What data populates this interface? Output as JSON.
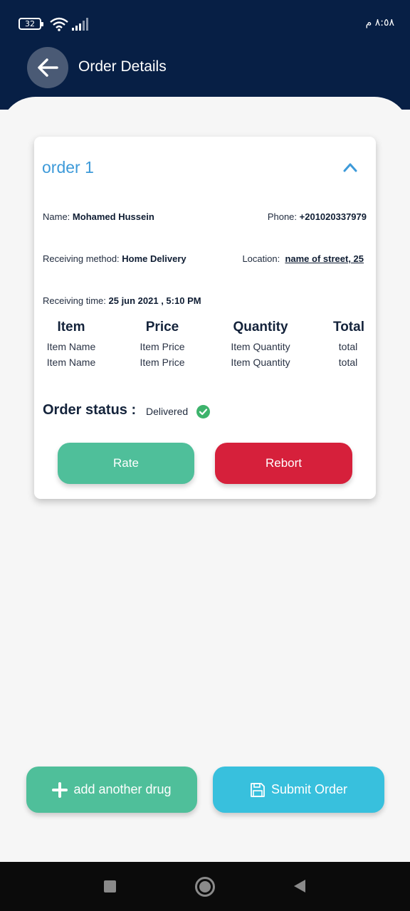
{
  "status_bar": {
    "battery": "32",
    "time": "٨:٥٨ م",
    "wifi_icon": "wifi-icon",
    "signal_icon": "signal-icon"
  },
  "header": {
    "title": "Order Details",
    "back_icon": "arrow-left-icon"
  },
  "order": {
    "title": "order 1",
    "name_label": "Name:",
    "name_value": "Mohamed Hussein",
    "phone_label": "Phone:",
    "phone_value": "+201020337979",
    "method_label": "Receiving method:",
    "method_value": "Home Delivery",
    "location_label": "Location:",
    "location_value": "name of street, 25",
    "time_label": "Receiving time:",
    "time_value": "25 jun 2021 , 5:10 PM",
    "table": {
      "headers": [
        "Item",
        "Price",
        "Quantity",
        "Total"
      ],
      "rows": [
        [
          "Item Name",
          "Item Price",
          "Item Quantity",
          "total"
        ],
        [
          "Item Name",
          "Item Price",
          "Item Quantity",
          "total"
        ]
      ]
    },
    "status_label": "Order status :",
    "status_value": "Delivered",
    "rate_label": "Rate",
    "report_label": "Rebort"
  },
  "actions": {
    "add_label": "add another drug",
    "submit_label": "Submit Order"
  },
  "colors": {
    "header_bg": "#071f45",
    "accent_blue": "#3d9ad9",
    "green": "#4fbf9a",
    "red": "#d6203b",
    "cyan": "#38c0dd",
    "check_green": "#3db36c"
  }
}
